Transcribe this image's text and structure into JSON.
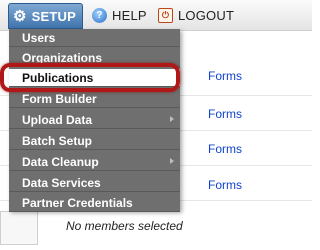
{
  "nav": {
    "setup_label": "SETUP",
    "help_label": "HELP",
    "logout_label": "LOGOUT"
  },
  "menu": {
    "items": [
      {
        "label": "Users",
        "submenu": false
      },
      {
        "label": "Organizations",
        "submenu": false
      },
      {
        "label": "Publications",
        "submenu": false,
        "highlighted": true
      },
      {
        "label": "Form Builder",
        "submenu": false
      },
      {
        "label": "Upload Data",
        "submenu": true
      },
      {
        "label": "Batch Setup",
        "submenu": false
      },
      {
        "label": "Data Cleanup",
        "submenu": true
      },
      {
        "label": "Data Services",
        "submenu": false
      },
      {
        "label": "Partner Credentials",
        "submenu": false
      }
    ]
  },
  "background": {
    "forms_links": [
      "Forms",
      "Forms",
      "Forms",
      "Forms"
    ],
    "footer_text": "No members selected"
  },
  "colors": {
    "setup_tab": "#3f74ad",
    "menu_bg": "#6f6f6f",
    "callout": "#b01818",
    "link": "#1144cc"
  }
}
